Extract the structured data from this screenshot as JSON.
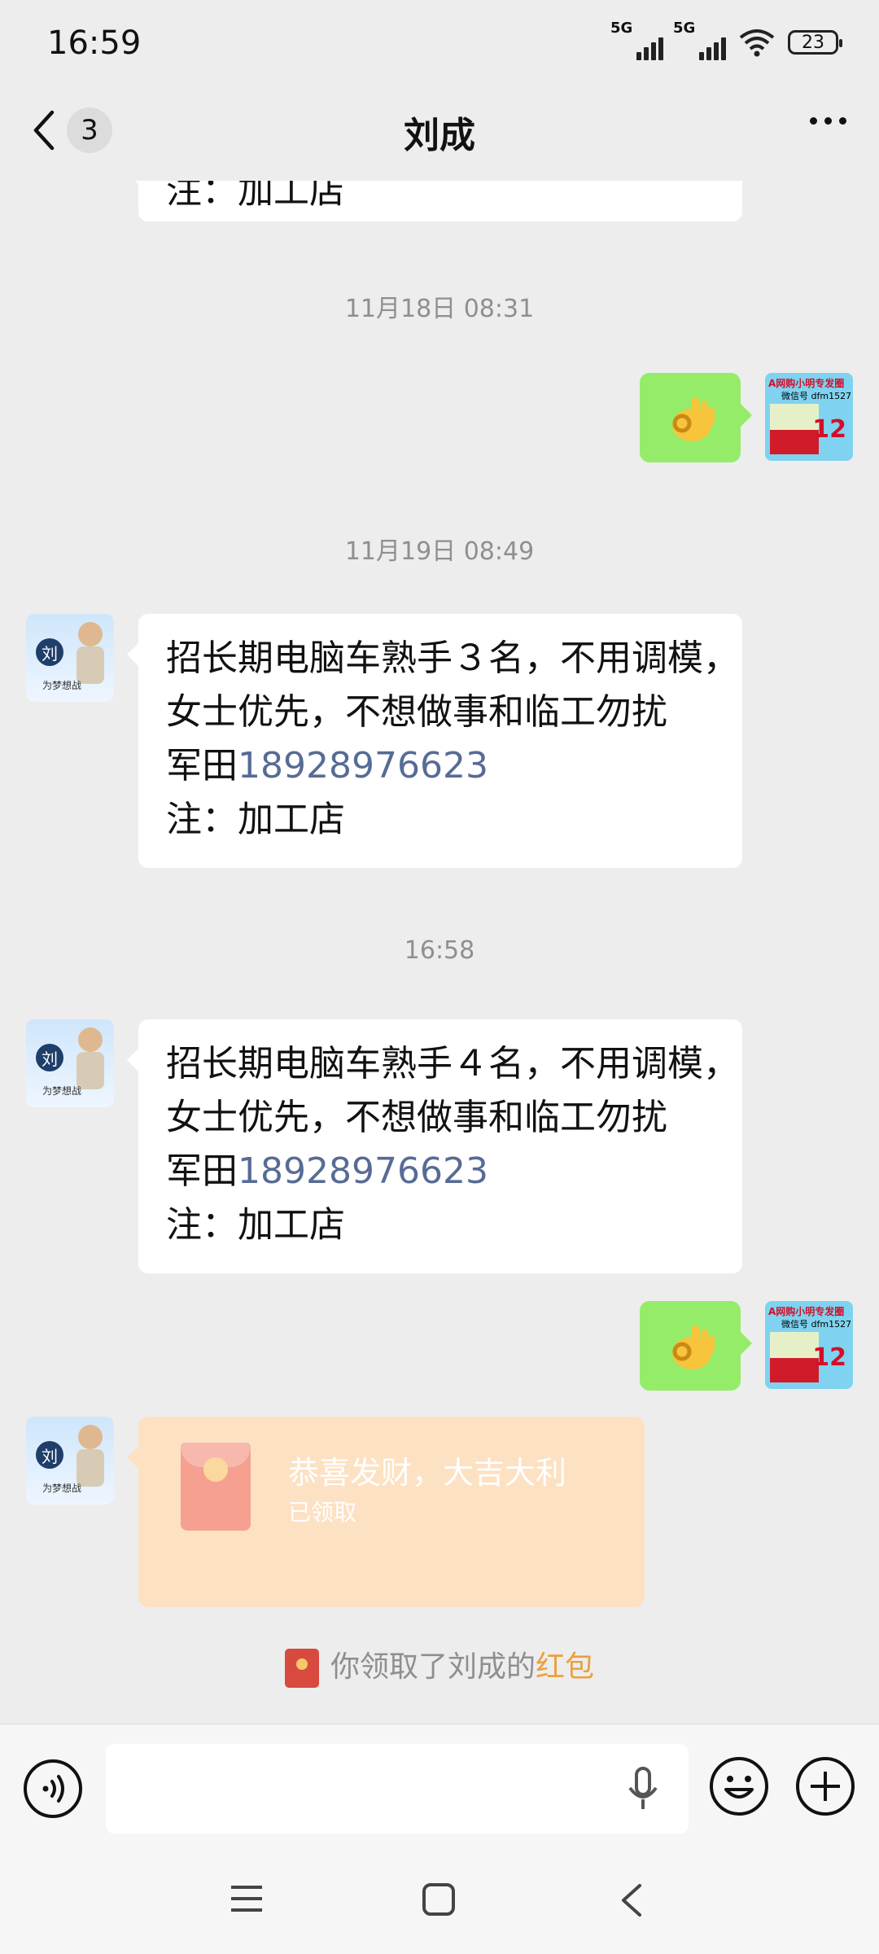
{
  "status_bar": {
    "time": "16:59",
    "signal1": "5G",
    "signal2": "5G",
    "battery": "23"
  },
  "header": {
    "unread_count": "3",
    "title": "刘成"
  },
  "messages": [
    {
      "type": "incoming_partial",
      "text": "注：加工店"
    },
    {
      "type": "timestamp",
      "text": "11月18日 08:31"
    },
    {
      "type": "outgoing_sticker",
      "sticker": "ok-hand-emoji"
    },
    {
      "type": "timestamp",
      "text": "11月19日 08:49"
    },
    {
      "type": "incoming_text",
      "lines": [
        "招长期电脑车熟手３名，不用调模，",
        "女士优先，不想做事和临工勿扰",
        "军田",
        "注：加工店"
      ],
      "phone": "18928976623"
    },
    {
      "type": "timestamp",
      "text": "16:58"
    },
    {
      "type": "incoming_text",
      "lines": [
        "招长期电脑车熟手４名，不用调模，",
        "女士优先，不想做事和临工勿扰",
        "军田",
        "注：加工店"
      ],
      "phone": "18928976623"
    },
    {
      "type": "outgoing_sticker",
      "sticker": "ok-hand-emoji"
    },
    {
      "type": "incoming_red_packet",
      "title": "恭喜发财，大吉大利",
      "status": "已领取"
    },
    {
      "type": "system",
      "prefix": "你领取了刘成的",
      "highlight": "红包"
    }
  ],
  "avatars": {
    "contact": {
      "logo_text": "刘",
      "caption": "为梦想战"
    },
    "self": {
      "line1": "A网购小明专发圈",
      "line2": "微信号 dfm1527",
      "badge": "12"
    }
  },
  "colors": {
    "outgoing_bubble": "#95ec69",
    "phone_link": "#576b95",
    "red_packet_bg": "#fde1c3",
    "highlight": "#ec9f3d"
  }
}
